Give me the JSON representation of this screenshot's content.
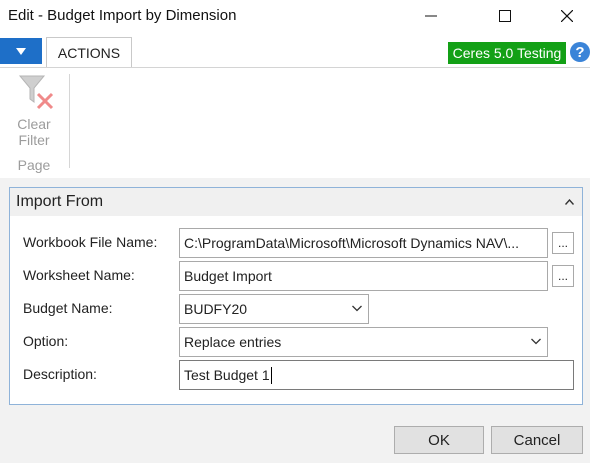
{
  "window": {
    "title": "Edit - Budget Import by Dimension"
  },
  "ribbon": {
    "tab_label": "ACTIONS",
    "company_badge": "Ceres 5.0 Testing",
    "help_glyph": "?",
    "actions": [
      {
        "label_line1": "Clear",
        "label_line2": "Filter",
        "icon": "clear-filter-icon",
        "enabled": false
      }
    ],
    "group_label": "Page"
  },
  "fasttab": {
    "title": "Import From",
    "fields": {
      "workbook_file_name": {
        "label": "Workbook File Name:",
        "value": "C:\\ProgramData\\Microsoft\\Microsoft Dynamics NAV\\..."
      },
      "worksheet_name": {
        "label": "Worksheet Name:",
        "value": "Budget Import"
      },
      "budget_name": {
        "label": "Budget Name:",
        "value": "BUDFY20"
      },
      "option": {
        "label": "Option:",
        "value": "Replace entries"
      },
      "description": {
        "label": "Description:",
        "value": "Test Budget 1"
      }
    },
    "assist_button_label": "..."
  },
  "buttons": {
    "ok": "OK",
    "cancel": "Cancel"
  },
  "colors": {
    "menu_button": "#1e6fc8",
    "company_badge": "#13a016",
    "help_icon": "#3b84d8",
    "fasttab_border": "#8fb3d9"
  }
}
